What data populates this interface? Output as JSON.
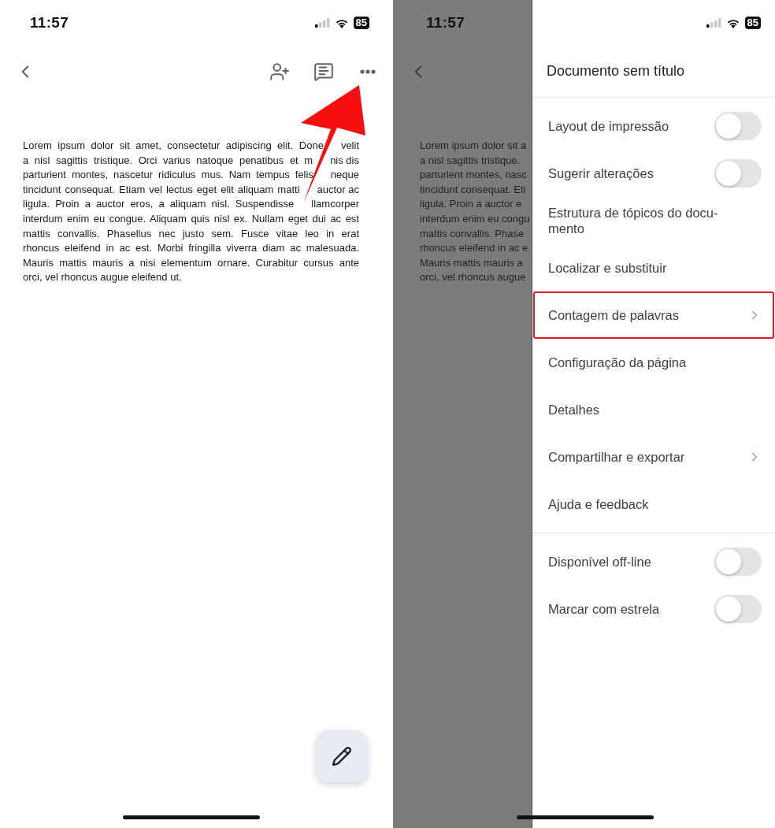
{
  "left_screen": {
    "status_bar": {
      "time": "11:57",
      "battery": "85"
    },
    "document_lines": [
      {
        "segments": [
          "Lorem ipsum dolor sit amet, consectetur adipiscing elit. Done",
          "velit"
        ]
      },
      {
        "segments": [
          "a nisl sagittis tristique. Orci varius natoque penatibus et m",
          "nis dis"
        ]
      },
      {
        "segments": [
          "parturient montes, nascetur ridiculus mus. Nam tempus felis",
          "neque"
        ]
      },
      {
        "segments": [
          "tincidunt consequat. Etiam vel lectus eget elit aliquam matti",
          "auctor ac"
        ]
      },
      {
        "segments": [
          "ligula. Proin a auctor eros, a aliquam nisl. Suspendisse",
          "llamcorper"
        ]
      },
      {
        "segments": [
          "interdum enim eu congue. Aliquam quis nisl ex. Nullam eget dui ac est"
        ]
      },
      {
        "segments": [
          "mattis convallis. Phasellus nec justo sem. Fusce vitae leo in erat"
        ]
      },
      {
        "segments": [
          "rhoncus eleifend in ac est. Morbi fringilla viverra diam ac malesuada."
        ]
      },
      {
        "segments": [
          "Mauris mattis mauris a nisi elementum ornare. Curabitur cursus ante"
        ]
      },
      {
        "segments": [
          "orci, vel rhoncus augue eleifend ut."
        ]
      }
    ]
  },
  "right_screen": {
    "status_bar": {
      "time": "11:57",
      "battery": "85"
    },
    "document_lines": [
      "Lorem ipsum dolor sit a",
      "a nisl sagittis tristique.",
      "parturient montes, nasc",
      "tincidunt consequat. Eti",
      "ligula. Proin a auctor e",
      "interdum enim eu congu",
      "mattis convallis. Phase",
      "rhoncus eleifend in ac e",
      "Mauris mattis mauris a",
      "orci, vel rhoncus augue"
    ],
    "menu": {
      "title": "Documento sem título",
      "sections": [
        {
          "items": [
            {
              "label": "Layout de impressão",
              "kind": "toggle",
              "on": false,
              "highlighted": false
            },
            {
              "label": "Sugerir alterações",
              "kind": "toggle",
              "on": false,
              "highlighted": false
            },
            {
              "label": "Estrutura de tópicos do docu-\nmento",
              "kind": "plain",
              "highlighted": false
            },
            {
              "label": "Localizar e substituir",
              "kind": "plain",
              "highlighted": false
            },
            {
              "label": "Contagem de palavras",
              "kind": "submenu",
              "highlighted": true
            },
            {
              "label": "Configuração da página",
              "kind": "plain",
              "highlighted": false
            },
            {
              "label": "Detalhes",
              "kind": "plain",
              "highlighted": false
            },
            {
              "label": "Compartilhar e exportar",
              "kind": "submenu",
              "highlighted": false
            },
            {
              "label": "Ajuda e feedback",
              "kind": "plain",
              "highlighted": false
            }
          ]
        },
        {
          "items": [
            {
              "label": "Disponível off-line",
              "kind": "toggle",
              "on": false,
              "highlighted": false
            },
            {
              "label": "Marcar com estrela",
              "kind": "toggle",
              "on": false,
              "highlighted": false
            }
          ]
        }
      ]
    }
  }
}
